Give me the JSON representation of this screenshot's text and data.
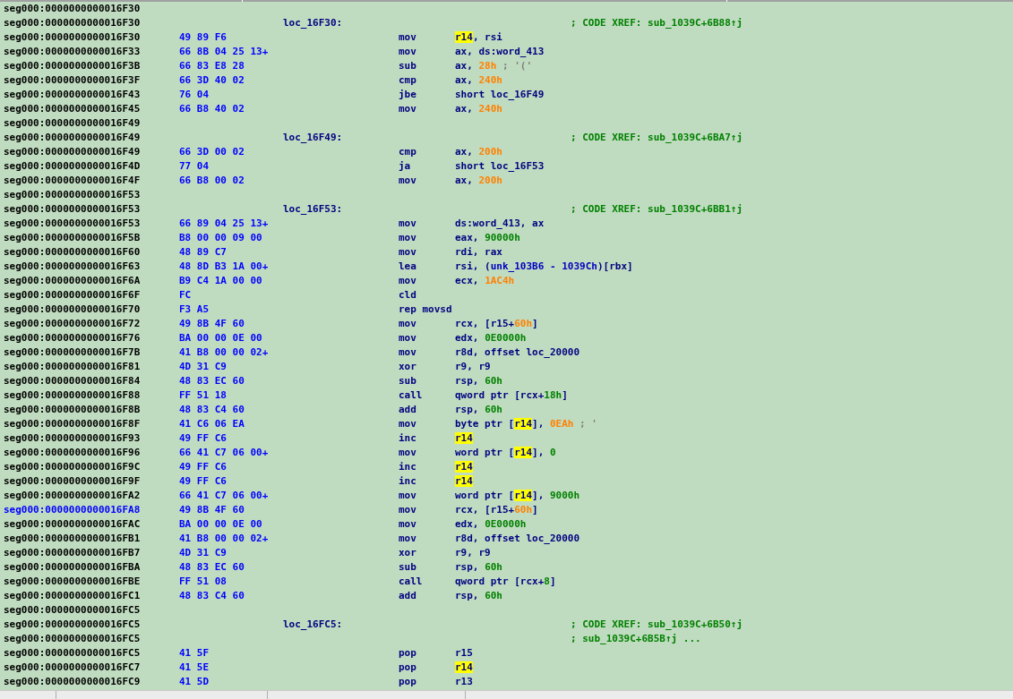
{
  "listing": {
    "rows": [
      {
        "address": "seg000:0000000000016F30",
        "selected": false
      },
      {
        "address": "seg000:0000000000016F30",
        "selected": false,
        "label": "loc_16F30:",
        "comment": "; CODE XREF: sub_1039C+6B88↑j"
      },
      {
        "address": "seg000:0000000000016F30",
        "selected": false,
        "bytes": "49 89 F6",
        "mnemonic": "mov",
        "operand": [
          {
            "kind": "highlight",
            "text": "r14"
          },
          {
            "kind": "plain",
            "text": ", rsi"
          }
        ]
      },
      {
        "address": "seg000:0000000000016F33",
        "selected": false,
        "bytes": "66 8B 04 25 13+",
        "mnemonic": "mov",
        "operand": [
          {
            "kind": "plain",
            "text": "ax, ds:word_413"
          }
        ]
      },
      {
        "address": "seg000:0000000000016F3B",
        "selected": false,
        "bytes": "66 83 E8 28",
        "mnemonic": "sub",
        "operand": [
          {
            "kind": "plain",
            "text": "ax, "
          },
          {
            "kind": "number",
            "text": "28h"
          },
          {
            "kind": "note",
            "text": " ; '('"
          }
        ]
      },
      {
        "address": "seg000:0000000000016F3F",
        "selected": false,
        "bytes": "66 3D 40 02",
        "mnemonic": "cmp",
        "operand": [
          {
            "kind": "plain",
            "text": "ax, "
          },
          {
            "kind": "number",
            "text": "240h"
          }
        ]
      },
      {
        "address": "seg000:0000000000016F43",
        "selected": false,
        "bytes": "76 04",
        "mnemonic": "jbe",
        "operand": [
          {
            "kind": "plain",
            "text": "short loc_16F49"
          }
        ]
      },
      {
        "address": "seg000:0000000000016F45",
        "selected": false,
        "bytes": "66 B8 40 02",
        "mnemonic": "mov",
        "operand": [
          {
            "kind": "plain",
            "text": "ax, "
          },
          {
            "kind": "number",
            "text": "240h"
          }
        ]
      },
      {
        "address": "seg000:0000000000016F49",
        "selected": false
      },
      {
        "address": "seg000:0000000000016F49",
        "selected": false,
        "label": "loc_16F49:",
        "comment": "; CODE XREF: sub_1039C+6BA7↑j"
      },
      {
        "address": "seg000:0000000000016F49",
        "selected": false,
        "bytes": "66 3D 00 02",
        "mnemonic": "cmp",
        "operand": [
          {
            "kind": "plain",
            "text": "ax, "
          },
          {
            "kind": "number",
            "text": "200h"
          }
        ]
      },
      {
        "address": "seg000:0000000000016F4D",
        "selected": false,
        "bytes": "77 04",
        "mnemonic": "ja",
        "operand": [
          {
            "kind": "plain",
            "text": "short loc_16F53"
          }
        ]
      },
      {
        "address": "seg000:0000000000016F4F",
        "selected": false,
        "bytes": "66 B8 00 02",
        "mnemonic": "mov",
        "operand": [
          {
            "kind": "plain",
            "text": "ax, "
          },
          {
            "kind": "number",
            "text": "200h"
          }
        ]
      },
      {
        "address": "seg000:0000000000016F53",
        "selected": false
      },
      {
        "address": "seg000:0000000000016F53",
        "selected": false,
        "label": "loc_16F53:",
        "comment": "; CODE XREF: sub_1039C+6BB1↑j"
      },
      {
        "address": "seg000:0000000000016F53",
        "selected": false,
        "bytes": "66 89 04 25 13+",
        "mnemonic": "mov",
        "operand": [
          {
            "kind": "plain",
            "text": "ds:word_413, ax"
          }
        ]
      },
      {
        "address": "seg000:0000000000016F5B",
        "selected": false,
        "bytes": "B8 00 00 09 00",
        "mnemonic": "mov",
        "operand": [
          {
            "kind": "plain",
            "text": "eax, "
          },
          {
            "kind": "constant",
            "text": "90000h"
          }
        ]
      },
      {
        "address": "seg000:0000000000016F60",
        "selected": false,
        "bytes": "48 89 C7",
        "mnemonic": "mov",
        "operand": [
          {
            "kind": "plain",
            "text": "rdi, rax"
          }
        ]
      },
      {
        "address": "seg000:0000000000016F63",
        "selected": false,
        "bytes": "48 8D B3 1A 00+",
        "mnemonic": "lea",
        "operand": [
          {
            "kind": "plain",
            "text": "rsi, ("
          },
          {
            "kind": "name",
            "text": "unk_103B6 - 1039Ch"
          },
          {
            "kind": "plain",
            "text": ")[rbx]"
          }
        ]
      },
      {
        "address": "seg000:0000000000016F6A",
        "selected": false,
        "bytes": "B9 C4 1A 00 00",
        "mnemonic": "mov",
        "operand": [
          {
            "kind": "plain",
            "text": "ecx, "
          },
          {
            "kind": "number",
            "text": "1AC4h"
          }
        ]
      },
      {
        "address": "seg000:0000000000016F6F",
        "selected": false,
        "bytes": "FC",
        "mnemonic": "cld"
      },
      {
        "address": "seg000:0000000000016F70",
        "selected": false,
        "bytes": "F3 A5",
        "mnemonic": "rep movsd"
      },
      {
        "address": "seg000:0000000000016F72",
        "selected": false,
        "bytes": "49 8B 4F 60",
        "mnemonic": "mov",
        "operand": [
          {
            "kind": "plain",
            "text": "rcx, [r15+"
          },
          {
            "kind": "number",
            "text": "60h"
          },
          {
            "kind": "plain",
            "text": "]"
          }
        ]
      },
      {
        "address": "seg000:0000000000016F76",
        "selected": false,
        "bytes": "BA 00 00 0E 00",
        "mnemonic": "mov",
        "operand": [
          {
            "kind": "plain",
            "text": "edx, "
          },
          {
            "kind": "constant",
            "text": "0E0000h"
          }
        ]
      },
      {
        "address": "seg000:0000000000016F7B",
        "selected": false,
        "bytes": "41 B8 00 00 02+",
        "mnemonic": "mov",
        "operand": [
          {
            "kind": "plain",
            "text": "r8d, offset loc_20000"
          }
        ]
      },
      {
        "address": "seg000:0000000000016F81",
        "selected": false,
        "bytes": "4D 31 C9",
        "mnemonic": "xor",
        "operand": [
          {
            "kind": "plain",
            "text": "r9, r9"
          }
        ]
      },
      {
        "address": "seg000:0000000000016F84",
        "selected": false,
        "bytes": "48 83 EC 60",
        "mnemonic": "sub",
        "operand": [
          {
            "kind": "plain",
            "text": "rsp, "
          },
          {
            "kind": "constant",
            "text": "60h"
          }
        ]
      },
      {
        "address": "seg000:0000000000016F88",
        "selected": false,
        "bytes": "FF 51 18",
        "mnemonic": "call",
        "operand": [
          {
            "kind": "plain",
            "text": "qword ptr [rcx+"
          },
          {
            "kind": "constant",
            "text": "18h"
          },
          {
            "kind": "plain",
            "text": "]"
          }
        ]
      },
      {
        "address": "seg000:0000000000016F8B",
        "selected": false,
        "bytes": "48 83 C4 60",
        "mnemonic": "add",
        "operand": [
          {
            "kind": "plain",
            "text": "rsp, "
          },
          {
            "kind": "constant",
            "text": "60h"
          }
        ]
      },
      {
        "address": "seg000:0000000000016F8F",
        "selected": false,
        "bytes": "41 C6 06 EA",
        "mnemonic": "mov",
        "operand": [
          {
            "kind": "plain",
            "text": "byte ptr ["
          },
          {
            "kind": "highlight",
            "text": "r14"
          },
          {
            "kind": "plain",
            "text": "], "
          },
          {
            "kind": "number",
            "text": "0EAh"
          },
          {
            "kind": "note",
            "text": " ; '"
          }
        ]
      },
      {
        "address": "seg000:0000000000016F93",
        "selected": false,
        "bytes": "49 FF C6",
        "mnemonic": "inc",
        "operand": [
          {
            "kind": "highlight",
            "text": "r14"
          }
        ]
      },
      {
        "address": "seg000:0000000000016F96",
        "selected": false,
        "bytes": "66 41 C7 06 00+",
        "mnemonic": "mov",
        "operand": [
          {
            "kind": "plain",
            "text": "word ptr ["
          },
          {
            "kind": "highlight",
            "text": "r14"
          },
          {
            "kind": "plain",
            "text": "], "
          },
          {
            "kind": "constant",
            "text": "0"
          }
        ]
      },
      {
        "address": "seg000:0000000000016F9C",
        "selected": false,
        "bytes": "49 FF C6",
        "mnemonic": "inc",
        "operand": [
          {
            "kind": "highlight",
            "text": "r14"
          }
        ]
      },
      {
        "address": "seg000:0000000000016F9F",
        "selected": false,
        "bytes": "49 FF C6",
        "mnemonic": "inc",
        "operand": [
          {
            "kind": "highlight",
            "text": "r14"
          }
        ]
      },
      {
        "address": "seg000:0000000000016FA2",
        "selected": false,
        "bytes": "66 41 C7 06 00+",
        "mnemonic": "mov",
        "operand": [
          {
            "kind": "plain",
            "text": "word ptr ["
          },
          {
            "kind": "highlight",
            "text": "r14"
          },
          {
            "kind": "plain",
            "text": "], "
          },
          {
            "kind": "constant",
            "text": "9000h"
          }
        ]
      },
      {
        "address": "seg000:0000000000016FA8",
        "selected": true,
        "bytes": "49 8B 4F 60",
        "mnemonic": "mov",
        "operand": [
          {
            "kind": "plain",
            "text": "rcx, [r15+"
          },
          {
            "kind": "number",
            "text": "60h"
          },
          {
            "kind": "plain",
            "text": "]"
          }
        ]
      },
      {
        "address": "seg000:0000000000016FAC",
        "selected": false,
        "bytes": "BA 00 00 0E 00",
        "mnemonic": "mov",
        "operand": [
          {
            "kind": "plain",
            "text": "edx, "
          },
          {
            "kind": "constant",
            "text": "0E0000h"
          }
        ]
      },
      {
        "address": "seg000:0000000000016FB1",
        "selected": false,
        "bytes": "41 B8 00 00 02+",
        "mnemonic": "mov",
        "operand": [
          {
            "kind": "plain",
            "text": "r8d, offset loc_20000"
          }
        ]
      },
      {
        "address": "seg000:0000000000016FB7",
        "selected": false,
        "bytes": "4D 31 C9",
        "mnemonic": "xor",
        "operand": [
          {
            "kind": "plain",
            "text": "r9, r9"
          }
        ]
      },
      {
        "address": "seg000:0000000000016FBA",
        "selected": false,
        "bytes": "48 83 EC 60",
        "mnemonic": "sub",
        "operand": [
          {
            "kind": "plain",
            "text": "rsp, "
          },
          {
            "kind": "constant",
            "text": "60h"
          }
        ]
      },
      {
        "address": "seg000:0000000000016FBE",
        "selected": false,
        "bytes": "FF 51 08",
        "mnemonic": "call",
        "operand": [
          {
            "kind": "plain",
            "text": "qword ptr [rcx+"
          },
          {
            "kind": "constant",
            "text": "8"
          },
          {
            "kind": "plain",
            "text": "]"
          }
        ]
      },
      {
        "address": "seg000:0000000000016FC1",
        "selected": false,
        "bytes": "48 83 C4 60",
        "mnemonic": "add",
        "operand": [
          {
            "kind": "plain",
            "text": "rsp, "
          },
          {
            "kind": "constant",
            "text": "60h"
          }
        ]
      },
      {
        "address": "seg000:0000000000016FC5",
        "selected": false
      },
      {
        "address": "seg000:0000000000016FC5",
        "selected": false,
        "label": "loc_16FC5:",
        "comment": "; CODE XREF: sub_1039C+6B50↑j"
      },
      {
        "address": "seg000:0000000000016FC5",
        "selected": false,
        "comment": "; sub_1039C+6B5B↑j ..."
      },
      {
        "address": "seg000:0000000000016FC5",
        "selected": false,
        "bytes": "41 5F",
        "mnemonic": "pop",
        "operand": [
          {
            "kind": "plain",
            "text": "r15"
          }
        ]
      },
      {
        "address": "seg000:0000000000016FC7",
        "selected": false,
        "bytes": "41 5E",
        "mnemonic": "pop",
        "operand": [
          {
            "kind": "highlight",
            "text": "r14"
          }
        ]
      },
      {
        "address": "seg000:0000000000016FC9",
        "selected": false,
        "bytes": "41 5D",
        "mnemonic": "pop",
        "operand": [
          {
            "kind": "plain",
            "text": "r13"
          }
        ]
      }
    ]
  }
}
